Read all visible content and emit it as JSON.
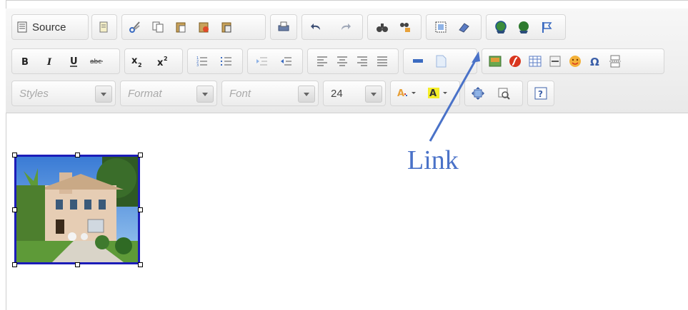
{
  "toolbar": {
    "source_label": "Source",
    "styles_placeholder": "Styles",
    "format_placeholder": "Format",
    "font_placeholder": "Font",
    "font_size_value": "24"
  },
  "annotation": {
    "label": "Link"
  },
  "colors": {
    "selection_border": "#1c1cb8",
    "annotation_color": "#4a72c8",
    "toolbar_bg": "#ececec"
  }
}
